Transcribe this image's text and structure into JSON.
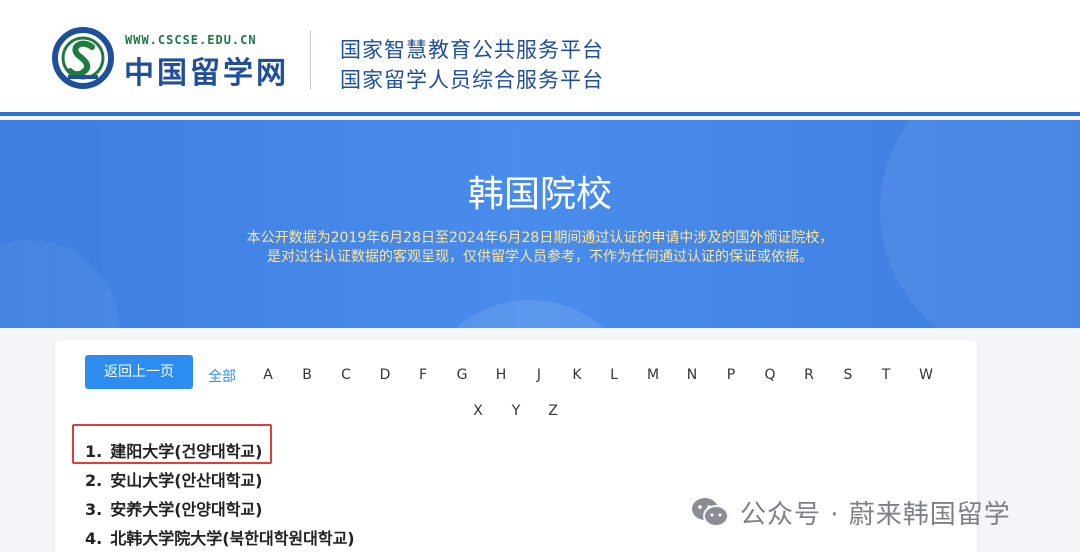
{
  "header": {
    "logo_url": "WWW.CSCSE.EDU.CN",
    "logo_name": "中国留学网",
    "platform_line1": "国家智慧教育公共服务平台",
    "platform_line2": "国家留学人员综合服务平台"
  },
  "banner": {
    "title": "韩国院校",
    "desc_line1": "本公开数据为2019年6月28日至2024年6月28日期间通过认证的申请中涉及的国外颁证院校，",
    "desc_line2": "是对过往认证数据的客观呈现，仅供留学人员参考，不作为任何通过认证的保证或依据。"
  },
  "toolbar": {
    "back_label": "返回上一页",
    "all_label": "全部",
    "letters_row1": [
      "A",
      "B",
      "C",
      "D",
      "F",
      "G",
      "H",
      "J",
      "K",
      "L",
      "M",
      "N",
      "P",
      "Q",
      "R",
      "S",
      "T",
      "W"
    ],
    "letters_row2": [
      "X",
      "Y",
      "Z"
    ]
  },
  "schools": [
    {
      "num": "1.",
      "name": "建阳大学(건양대학교)"
    },
    {
      "num": "2.",
      "name": "安山大学(안산대학교)"
    },
    {
      "num": "3.",
      "name": "安养大学(안양대학교)"
    },
    {
      "num": "4.",
      "name": "北韩大学院大学(북한대학원대학교)"
    }
  ],
  "watermark": {
    "text": "公众号 · 蔚来韩国留学",
    "icon": "wechat-icon"
  },
  "colors": {
    "brand_blue": "#2f6fd6",
    "button_blue": "#2d8cf0",
    "desc_yellow": "#ffe79a",
    "highlight_red": "#e23b3b"
  }
}
